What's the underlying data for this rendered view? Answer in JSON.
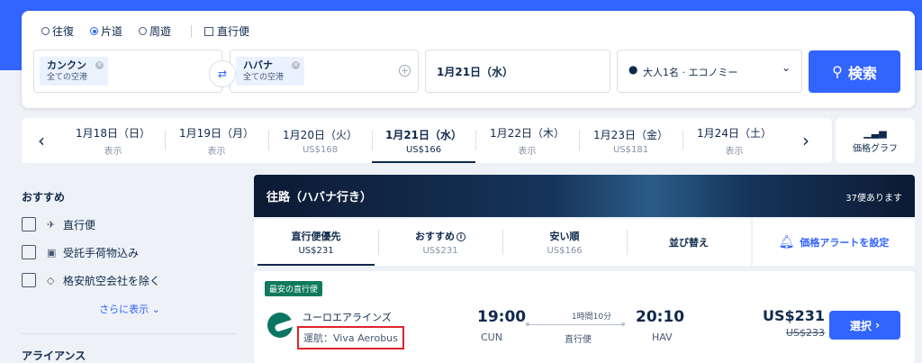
{
  "colors": {
    "accent": "#3264ff",
    "text": "#0f294d",
    "tag_green": "#0f7a5c",
    "highlight_red": "#e0232a"
  },
  "trip_types": [
    {
      "label": "往復",
      "selected": false
    },
    {
      "label": "片道",
      "selected": true
    },
    {
      "label": "周遊",
      "selected": false
    }
  ],
  "direct_only": {
    "label": "直行便",
    "checked": false
  },
  "from": {
    "city": "カンクン",
    "sub": "全ての空港"
  },
  "to": {
    "city": "ハバナ",
    "sub": "全ての空港"
  },
  "date": "1月21日（水）",
  "passengers": "大人1名 · エコノミー",
  "search_label": "検索",
  "icons": {
    "search": "search-icon",
    "swap": "swap-icon",
    "person": "person-icon",
    "chart": "bar-chart-icon",
    "bell": "bell-icon"
  },
  "date_strip": [
    {
      "date": "1月18日（日）",
      "price": "表示"
    },
    {
      "date": "1月19日（月）",
      "price": "表示"
    },
    {
      "date": "1月20日（火）",
      "price": "US$168"
    },
    {
      "date": "1月21日（水）",
      "price": "US$166",
      "active": true
    },
    {
      "date": "1月22日（木）",
      "price": "表示"
    },
    {
      "date": "1月23日（金）",
      "price": "US$181"
    },
    {
      "date": "1月24日（土）",
      "price": "表示"
    }
  ],
  "price_graph_label": "価格グラフ",
  "sidebar": {
    "title": "おすすめ",
    "filters": [
      "直行便",
      "受託手荷物込み",
      "格安航空会社を除く"
    ],
    "show_more": "さらに表示",
    "alliance_title": "アライアンス"
  },
  "results": {
    "banner_title": "往路（ハバナ行き）",
    "flight_count": "37便あります",
    "sort_tabs": [
      {
        "label": "直行便優先",
        "price": "US$231",
        "active": true
      },
      {
        "label": "おすすめ",
        "price": "US$231",
        "info": true
      },
      {
        "label": "安い順",
        "price": "US$166"
      },
      {
        "label": "並び替え",
        "price": ""
      }
    ],
    "price_alert": "価格アラートを設定",
    "flight": {
      "tag": "最安の直行便",
      "airline": "ユーロエアラインズ",
      "operated_by": "運航：Viva Aerobus",
      "dep_time": "19:00",
      "dep_code": "CUN",
      "duration": "1時間10分",
      "stops": "直行便",
      "arr_time": "20:10",
      "arr_code": "HAV",
      "price": "US$231",
      "old_price": "US$233",
      "select_label": "選択"
    }
  }
}
